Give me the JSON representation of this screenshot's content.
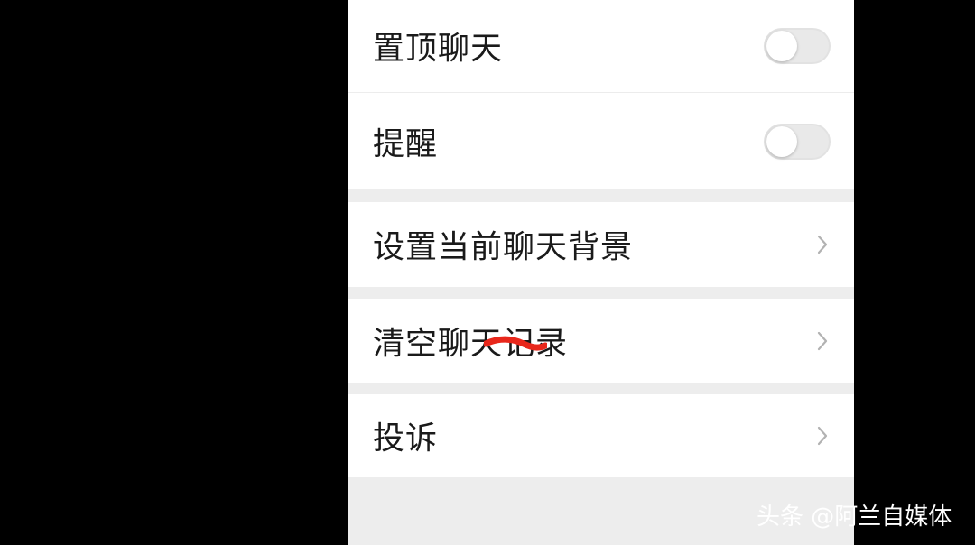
{
  "settings": {
    "pin_chat": {
      "label": "置顶聊天",
      "enabled": false
    },
    "reminder": {
      "label": "提醒",
      "enabled": false
    },
    "set_background": {
      "label": "设置当前聊天背景"
    },
    "clear_history": {
      "label": "清空聊天记录"
    },
    "complaint": {
      "label": "投诉"
    }
  },
  "watermark": "头条 @阿兰自媒体",
  "colors": {
    "outer_background": "#000000",
    "group_gap": "#ededed",
    "row_background": "#ffffff",
    "toggle_off": "#e9e9e9",
    "annotation_stroke": "#e8271b"
  },
  "icons": {
    "chevron": "chevron-right-icon"
  }
}
